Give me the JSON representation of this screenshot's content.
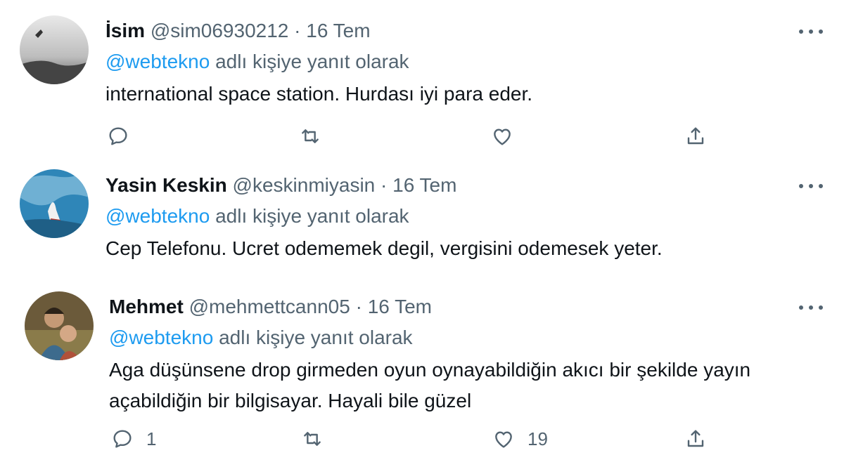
{
  "colors": {
    "accent": "#1d9bf0",
    "muted": "#536471",
    "text": "#0f1419"
  },
  "tweets": [
    {
      "name": "İsim",
      "handle": "@sim06930212",
      "separator": "·",
      "date": "16 Tem",
      "reply_mention": "@webtekno",
      "reply_suffix": "adlı kişiye yanıt olarak",
      "text": "international space station. Hurdası iyi para eder.",
      "reply_count": "",
      "like_count": ""
    },
    {
      "name": "Yasin Keskin",
      "handle": "@keskinmiyasin",
      "separator": "·",
      "date": "16 Tem",
      "reply_mention": "@webtekno",
      "reply_suffix": "adlı kişiye yanıt olarak",
      "text": "Cep Telefonu. Ucret odememek degil, vergisini odemesek yeter."
    },
    {
      "name": "Mehmet",
      "handle": "@mehmettcann05",
      "separator": "·",
      "date": "16 Tem",
      "reply_mention": "@webtekno",
      "reply_suffix": "adlı kişiye yanıt olarak",
      "text": "Aga düşünsene drop girmeden oyun oynayabildiğin akıcı bir şekilde yayın açabildiğin bir bilgisayar. Hayali bile güzel",
      "reply_count": "1",
      "like_count": "19"
    }
  ],
  "icons": {
    "reply": "reply-icon",
    "retweet": "retweet-icon",
    "like": "like-icon",
    "share": "share-icon",
    "more": "more-icon"
  }
}
